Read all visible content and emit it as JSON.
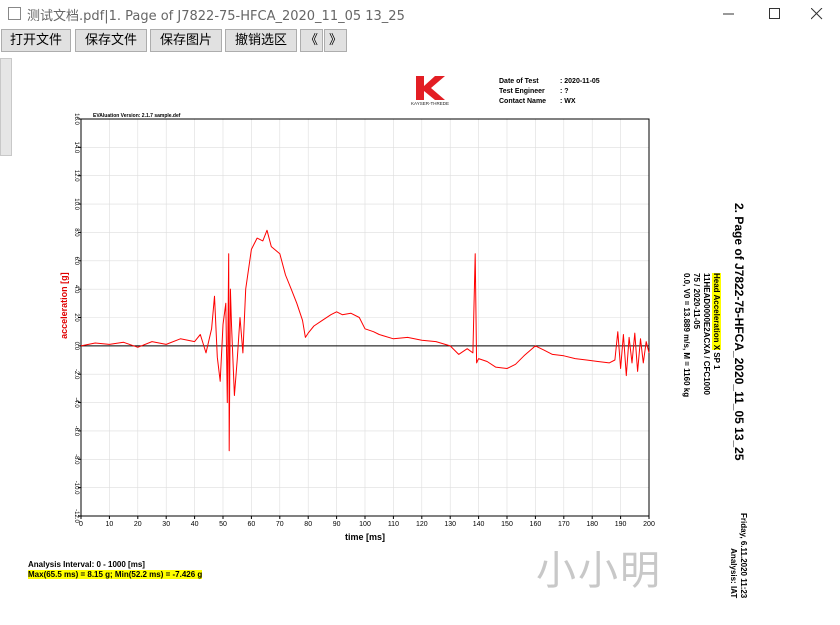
{
  "window": {
    "title": "测试文档.pdf|1. Page of J7822-75-HFCA_2020_11_05 13_25"
  },
  "toolbar": {
    "buttons": [
      "打开文件",
      "保存文件",
      "保存图片",
      "撤销选区",
      "《",
      "》"
    ]
  },
  "report": {
    "logo_caption": "KAYSER-THREDE",
    "header": [
      {
        "label": "Date of Test",
        "value": ": 2020-11-05"
      },
      {
        "label": "Test Engineer",
        "value": ": ?"
      },
      {
        "label": "Contact Name",
        "value": ": WX"
      }
    ],
    "eval_version": "EVAluation Version: 2.1.7 sample.def",
    "side_title": "2. Page of J7822-75-HFCA_2020_11_05 13_25",
    "channel": {
      "name": "Head Acceleration X",
      "suffix": " SP 1",
      "code": "11HEAD0000E2ACXA / CFC1000",
      "test": "75 / 2020-11-05",
      "conditions": "0.0, V0 = 13.889 m/s, M = 1160 kg"
    },
    "footer_date": "Friday, 6.11.2020  11:23",
    "footer_analysis": "Analysis: IAT",
    "analysis_interval": "Analysis Interval:  0 - 1000 [ms]",
    "extremes": "Max(65.5 ms) = 8.15 g; Min(52.2 ms) = -7.426 g",
    "watermark": "小小明"
  },
  "chart_data": {
    "type": "line",
    "xlabel": "time [ms]",
    "ylabel": "acceleration [g]",
    "xlim": [
      0,
      200
    ],
    "ylim": [
      -12,
      16
    ],
    "xticks": [
      0,
      10,
      20,
      30,
      40,
      50,
      60,
      70,
      80,
      90,
      100,
      110,
      120,
      130,
      140,
      150,
      160,
      170,
      180,
      190,
      200
    ],
    "yticks": [
      -12,
      -10,
      -8,
      -6,
      -4,
      -2,
      0,
      2,
      4,
      6,
      8,
      10,
      12,
      14,
      16
    ],
    "grid": true,
    "colors": {
      "series": "#ff0000",
      "axis": "#000000",
      "grid": "#dddddd"
    },
    "series": [
      {
        "name": "Head Acceleration X",
        "x": [
          0,
          5,
          10,
          15,
          20,
          25,
          30,
          35,
          40,
          42,
          44,
          46,
          47,
          48,
          49,
          50,
          51,
          51.5,
          52,
          52.2,
          52.6,
          53,
          54,
          55,
          56,
          57,
          58,
          60,
          62,
          64,
          65.5,
          67,
          70,
          72,
          74,
          76,
          78,
          79,
          80,
          82,
          85,
          88,
          90,
          92,
          95,
          98,
          100,
          103,
          105,
          110,
          115,
          120,
          125,
          130,
          133,
          136,
          138,
          138.8,
          139.3,
          140,
          143,
          146,
          150,
          153,
          156,
          160,
          163,
          166,
          170,
          174,
          178,
          182,
          186,
          188,
          189,
          190,
          191,
          192,
          193,
          194,
          195,
          196,
          197,
          198,
          199,
          200
        ],
        "y": [
          0.0,
          0.2,
          0.1,
          0.25,
          -0.1,
          0.3,
          0.1,
          0.5,
          0.3,
          0.8,
          -0.5,
          1.2,
          3.5,
          -0.8,
          -2.5,
          1.5,
          3.0,
          -4.0,
          6.5,
          -7.4,
          4.0,
          1.5,
          -3.5,
          -1.0,
          2.0,
          -0.5,
          4.0,
          6.8,
          7.6,
          7.4,
          8.15,
          7.0,
          6.5,
          5.0,
          4.0,
          3.0,
          1.8,
          0.6,
          0.9,
          1.4,
          1.8,
          2.2,
          2.4,
          2.2,
          2.3,
          2.0,
          1.2,
          1.0,
          0.8,
          0.5,
          0.6,
          0.4,
          0.3,
          0.0,
          -0.6,
          -0.2,
          -0.5,
          6.5,
          -1.2,
          -0.9,
          -1.1,
          -1.5,
          -1.6,
          -1.3,
          -0.7,
          0.0,
          -0.3,
          -0.6,
          -0.7,
          -0.9,
          -1.0,
          -1.1,
          -1.2,
          -1.0,
          1.0,
          -1.6,
          0.8,
          -2.1,
          0.6,
          -1.2,
          0.9,
          -1.8,
          0.5,
          -1.2,
          0.3,
          -0.5
        ]
      }
    ],
    "annotation": "EVAluation Version: 2.1.7 sample.def"
  }
}
